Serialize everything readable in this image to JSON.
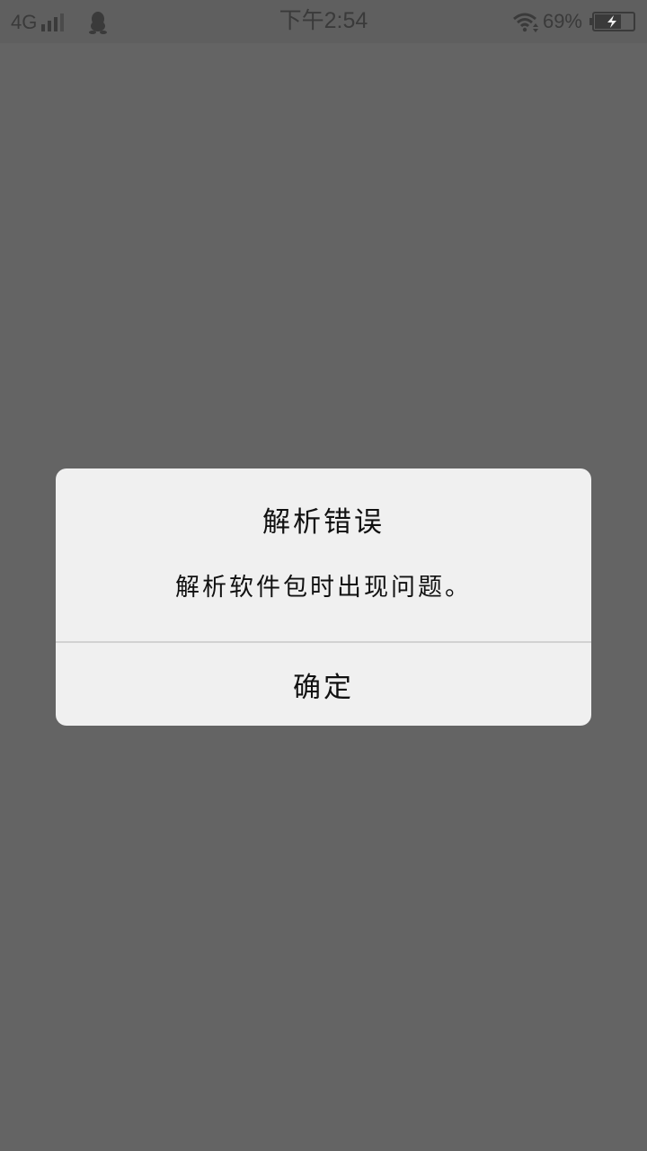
{
  "status_bar": {
    "network": "4G",
    "time": "下午2:54",
    "battery_percent": "69%",
    "battery_level": 0.69,
    "charging": true,
    "icons": [
      "signal-icon",
      "qq-icon",
      "wifi-icon",
      "battery-charging-icon"
    ]
  },
  "dialog": {
    "title": "解析错误",
    "message": "解析软件包时出现问题。",
    "confirm_label": "确定"
  },
  "colors": {
    "overlay": "#646464",
    "dialog_bg": "#f0f0f0",
    "text": "#111111",
    "divider": "#d2d2d2"
  }
}
